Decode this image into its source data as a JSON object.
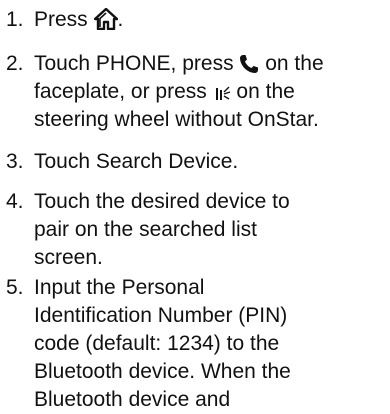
{
  "steps": [
    {
      "number": "1.",
      "parts": {
        "before_icon": "Press ",
        "after_icon": "."
      },
      "icon": "home-icon"
    },
    {
      "number": "2.",
      "line1": {
        "before_icon": "Touch PHONE, press ",
        "after_icon": " on the"
      },
      "line2": {
        "before_icon": "faceplate, or press ",
        "after_icon": " on the"
      },
      "line3": "steering wheel without OnStar.",
      "icons": [
        "phone-handset-icon",
        "voice-call-icon"
      ]
    },
    {
      "number": "3.",
      "lines": [
        "Touch Search Device."
      ]
    },
    {
      "number": "4.",
      "lines": [
        "Touch the desired device to",
        "pair on the searched list",
        "screen."
      ]
    },
    {
      "number": "5.",
      "lines": [
        "Input the Personal",
        "Identification Number (PIN)",
        "code (default: 1234) to the",
        "Bluetooth device. When the",
        "Bluetooth device and"
      ]
    }
  ]
}
